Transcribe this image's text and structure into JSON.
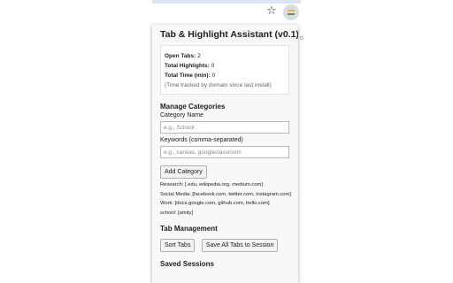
{
  "toolbar": {
    "bookmark_icon": "star-icon",
    "extension_icon": "highlighter-extension-icon",
    "edge_glyph": "o"
  },
  "popup": {
    "title": "Tab & Highlight Assistant (v0.1)",
    "stats": {
      "open_tabs_label": "Open Tabs:",
      "open_tabs_value": "2",
      "total_highlights_label": "Total Highlights:",
      "total_highlights_value": "0",
      "total_time_label": "Total Time (min):",
      "total_time_value": "0",
      "note": "(Time tracked by domain since last install)"
    },
    "manage_categories": {
      "heading": "Manage Categories",
      "category_name_label": "Category Name",
      "category_name_placeholder": "e.g., School",
      "keywords_label": "Keywords (comma-separated)",
      "keywords_placeholder": "e.g., canvas, googleclassroom",
      "add_button": "Add Category",
      "categories": [
        "Research: [.edu, wikipedia.org, medium.com]",
        "Social Media: [facebook.com, twitter.com, instagram.com]",
        "Work: [docs.google.com, github.com, trello.com]",
        "school: [amity]"
      ]
    },
    "tab_management": {
      "heading": "Tab Management",
      "sort_button": "Sort Tabs",
      "save_all_button": "Save All Tabs to Session"
    },
    "saved_sessions": {
      "heading": "Saved Sessions"
    }
  }
}
